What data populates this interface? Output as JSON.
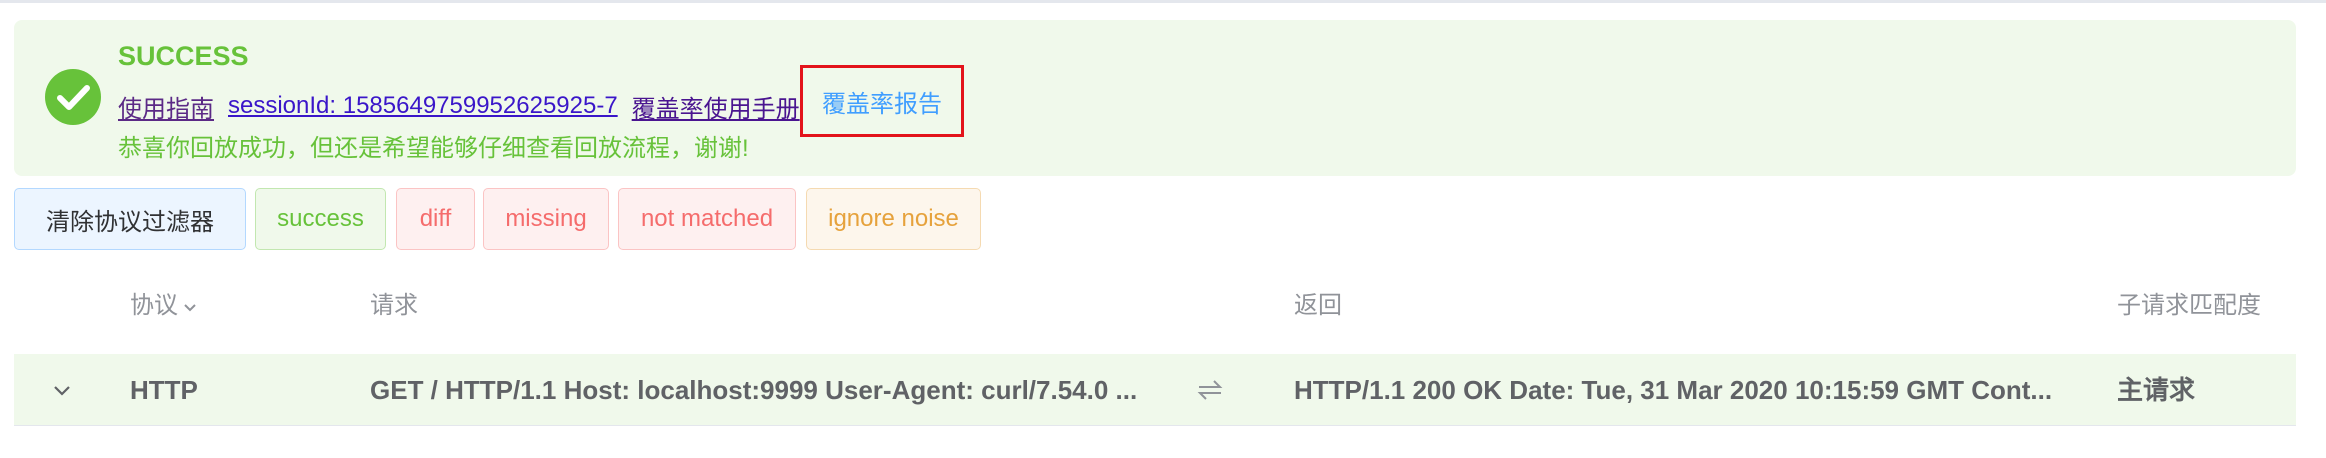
{
  "alert": {
    "title": "SUCCESS",
    "links": {
      "guide": "使用指南",
      "session": "sessionId: 1585649759952625925-7",
      "coverage_manual": "覆盖率使用手册",
      "coverage_report": "覆盖率报告"
    },
    "description": "恭喜你回放成功，但还是希望能够仔细查看回放流程，谢谢!",
    "colors": {
      "success": "#67c23a",
      "highlight_border": "#e3141b",
      "link": "#409eff"
    }
  },
  "filters": {
    "clear_label": "清除协议过滤器",
    "items": [
      {
        "label": "success",
        "color": "#67c23a"
      },
      {
        "label": "diff",
        "color": "#f56c6c"
      },
      {
        "label": "missing",
        "color": "#f56c6c"
      },
      {
        "label": "not matched",
        "color": "#f56c6c"
      },
      {
        "label": "ignore noise",
        "color": "#e6a23c"
      }
    ]
  },
  "table": {
    "headers": {
      "protocol": "协议",
      "request": "请求",
      "response": "返回",
      "match": "子请求匹配度"
    },
    "rows": [
      {
        "protocol": "HTTP",
        "request": "GET / HTTP/1.1 Host: localhost:9999 User-Agent: curl/7.54.0 ...",
        "response": "HTTP/1.1 200 OK Date: Tue, 31 Mar 2020 10:15:59 GMT Cont...",
        "match": "主请求",
        "expand_icon": "chevron-down-icon",
        "swap_icon": "swap-arrows-icon"
      }
    ]
  }
}
